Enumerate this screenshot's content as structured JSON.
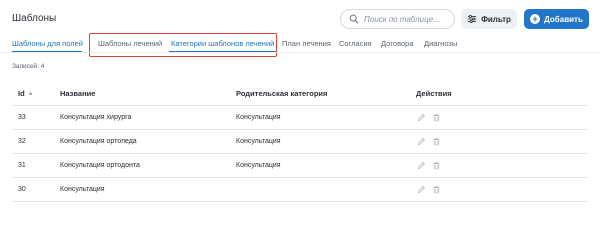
{
  "header": {
    "title": "Шаблоны",
    "search_placeholder": "Поиск по таблице...",
    "filter_label": "Фильтр",
    "add_label": "Добавить"
  },
  "tabs": [
    {
      "label": "Шаблоны для полей",
      "active": true
    },
    {
      "label": "Шаблоны лечений",
      "active": false
    },
    {
      "label": "Категории шаблонов лечений",
      "active": true
    },
    {
      "label": "План лечения",
      "active": false
    },
    {
      "label": "Согласия",
      "active": false
    },
    {
      "label": "Договора",
      "active": false
    },
    {
      "label": "Диагнозы",
      "active": false
    }
  ],
  "records_label": "Записей: 4",
  "table": {
    "columns": {
      "id": "Id",
      "name": "Название",
      "parent": "Родительская категория",
      "actions": "Действия"
    },
    "rows": [
      {
        "id": "33",
        "name": "Консультация хирурга",
        "parent": "Консультация"
      },
      {
        "id": "32",
        "name": "Консультация ортопеда",
        "parent": "Консультация"
      },
      {
        "id": "31",
        "name": "Консультация ортодонта",
        "parent": "Консультация"
      },
      {
        "id": "30",
        "name": "Консультация",
        "parent": ""
      }
    ]
  },
  "colors": {
    "accent": "#2276c9",
    "highlight": "#d9443a",
    "icon_muted": "#b5bcc6"
  },
  "icons": {
    "search": "search-icon",
    "filter": "sliders-icon",
    "add": "plus-icon",
    "edit": "pencil-icon",
    "delete": "trash-icon",
    "sort": "sort-arrow-icon"
  }
}
